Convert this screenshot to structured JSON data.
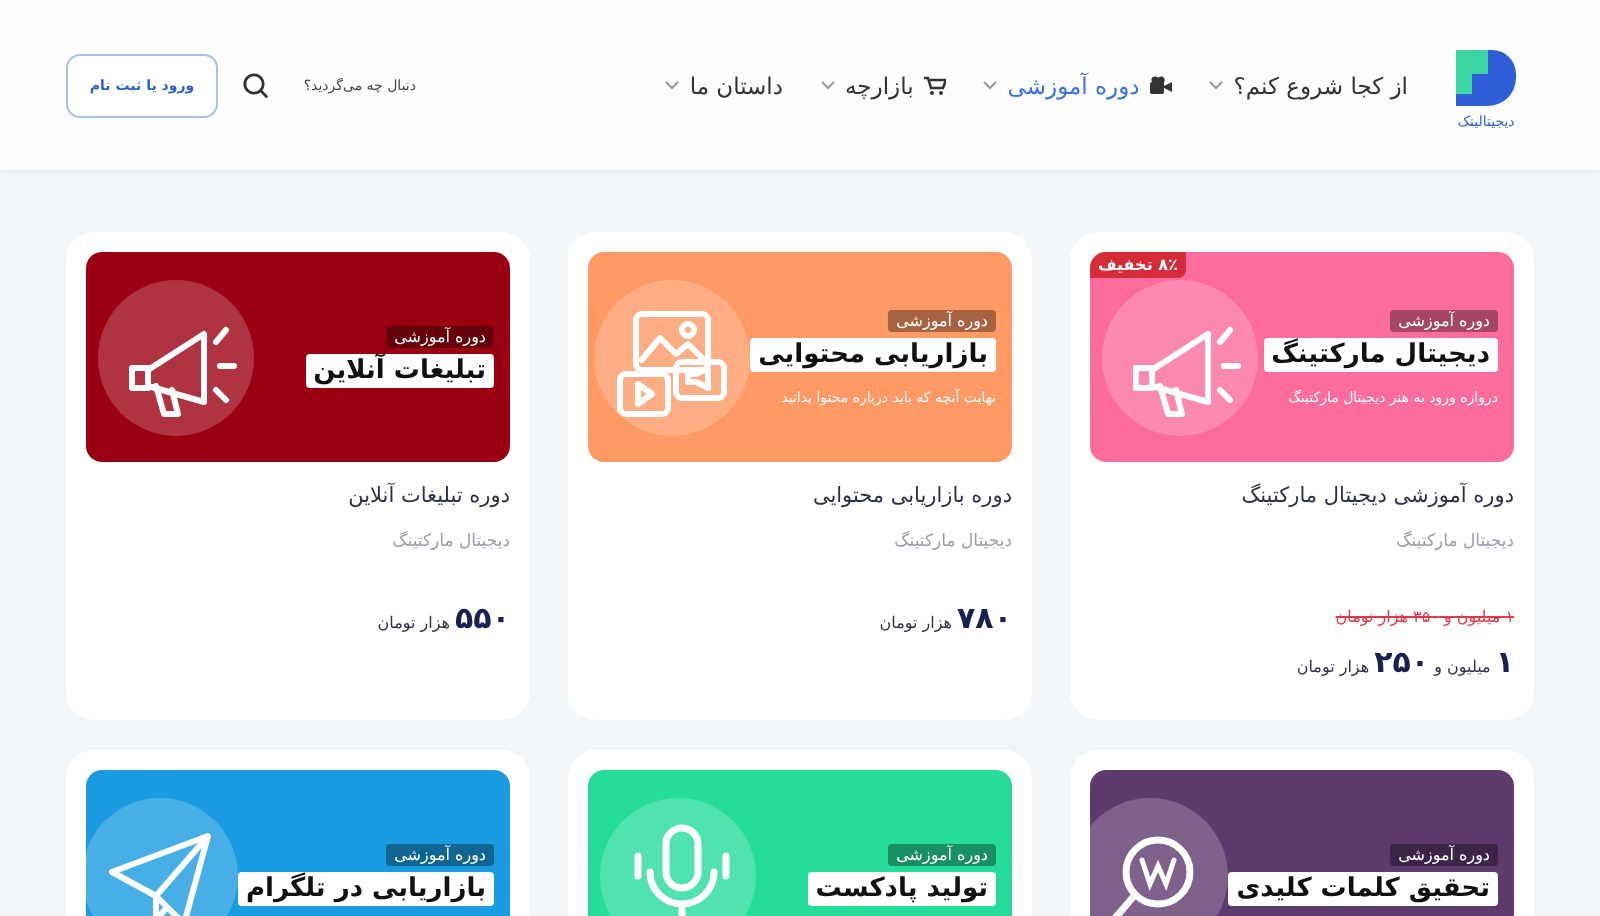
{
  "header": {
    "logo_text": "دیجیتالینک",
    "nav": [
      {
        "label": "از کجا شروع کنم؟",
        "kind": "dropdown",
        "selected": false
      },
      {
        "label": "دوره آموزشی",
        "kind": "course",
        "selected": true
      },
      {
        "label": "بازارچه",
        "kind": "shop",
        "selected": false
      },
      {
        "label": "داستان ما",
        "kind": "dropdown",
        "selected": false
      }
    ],
    "search": {
      "placeholder": "دنبال چه می‌گردید؟"
    },
    "login_button": "ورود یا ثبت نام"
  },
  "courses": [
    {
      "banner": {
        "kind": "megaphone",
        "color": "#fd6c9e",
        "tag": "دوره آموزشی",
        "headline": "دیجیتال مارکتینگ",
        "subtitle": "دروازه ورود به هنر دیجیتال مارکتینگ",
        "badge": "۸٪ تخفیف"
      },
      "title": "دوره آموزشی دیجیتال مارکتینگ",
      "category": "دیجیتال مارکتینگ",
      "old_price": "۱ میلیون و ۳۵۰ هزار تومان",
      "price": "**۱** میلیون و **۲۵۰** هزار تومان"
    },
    {
      "banner": {
        "kind": "media",
        "color": "#ff9966",
        "tag": "دوره آموزشی",
        "headline": "بازاریابی محتوایی",
        "subtitle": "نهایت آنچه که باید درباره محتوا بدانید"
      },
      "title": "دوره بازاریابی محتوایی",
      "category": "دیجیتال مارکتینگ",
      "price": "**۷۸۰** هزار تومان"
    },
    {
      "banner": {
        "kind": "megaphone",
        "color": "#9b0012",
        "tag": "دوره آموزشی",
        "headline": "تبلیغات آنلاین"
      },
      "title": "دوره تبلیغات آنلاین",
      "category": "دیجیتال مارکتینگ",
      "price": "**۵۵۰** هزار تومان"
    },
    {
      "banner": {
        "kind": "magnifier",
        "color": "#5f3a6f",
        "tag": "دوره آموزشی",
        "headline": "تحقیق کلمات کلیدی"
      }
    },
    {
      "banner": {
        "kind": "microphone",
        "color": "#26dc9b",
        "tag": "دوره آموزشی",
        "headline": "تولید پادکست"
      }
    },
    {
      "banner": {
        "kind": "paper-plane",
        "color": "#1a9be0",
        "tag": "دوره آموزشی",
        "headline": "بازاریابی در تلگرام"
      }
    }
  ]
}
